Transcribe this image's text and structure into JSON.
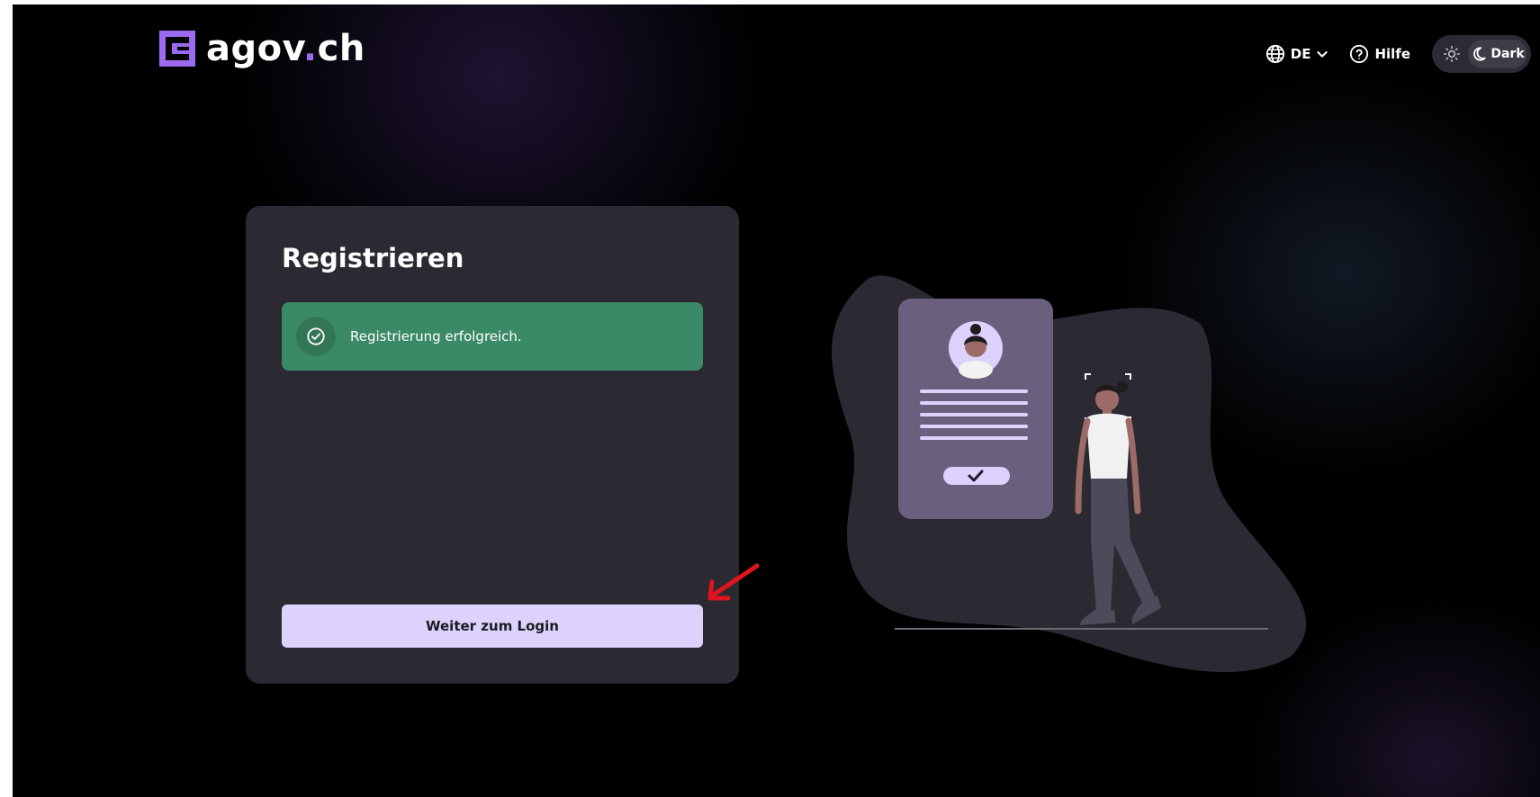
{
  "header": {
    "logo": {
      "name": "agov",
      "dot": ".",
      "tld": "ch"
    },
    "language": {
      "icon": "globe-icon",
      "label": "DE",
      "caret": "chevron-down-icon"
    },
    "help": {
      "icon": "question-circle-icon",
      "label": "Hilfe"
    },
    "theme": {
      "light_icon": "sun-icon",
      "dark_icon": "moon-icon",
      "dark_label": "Dark"
    }
  },
  "card": {
    "title": "Registrieren",
    "alert": {
      "icon": "check-circle-icon",
      "message": "Registrierung erfolgreich."
    },
    "login_button": "Weiter zum Login"
  },
  "annotation": {
    "icon": "red-arrow-icon",
    "color": "#e0141e"
  },
  "colors": {
    "background": "#000000",
    "card": "#2b2a33",
    "success": "#3b8a67",
    "button": "#dcd2fb",
    "brand": "#9b6af0"
  }
}
